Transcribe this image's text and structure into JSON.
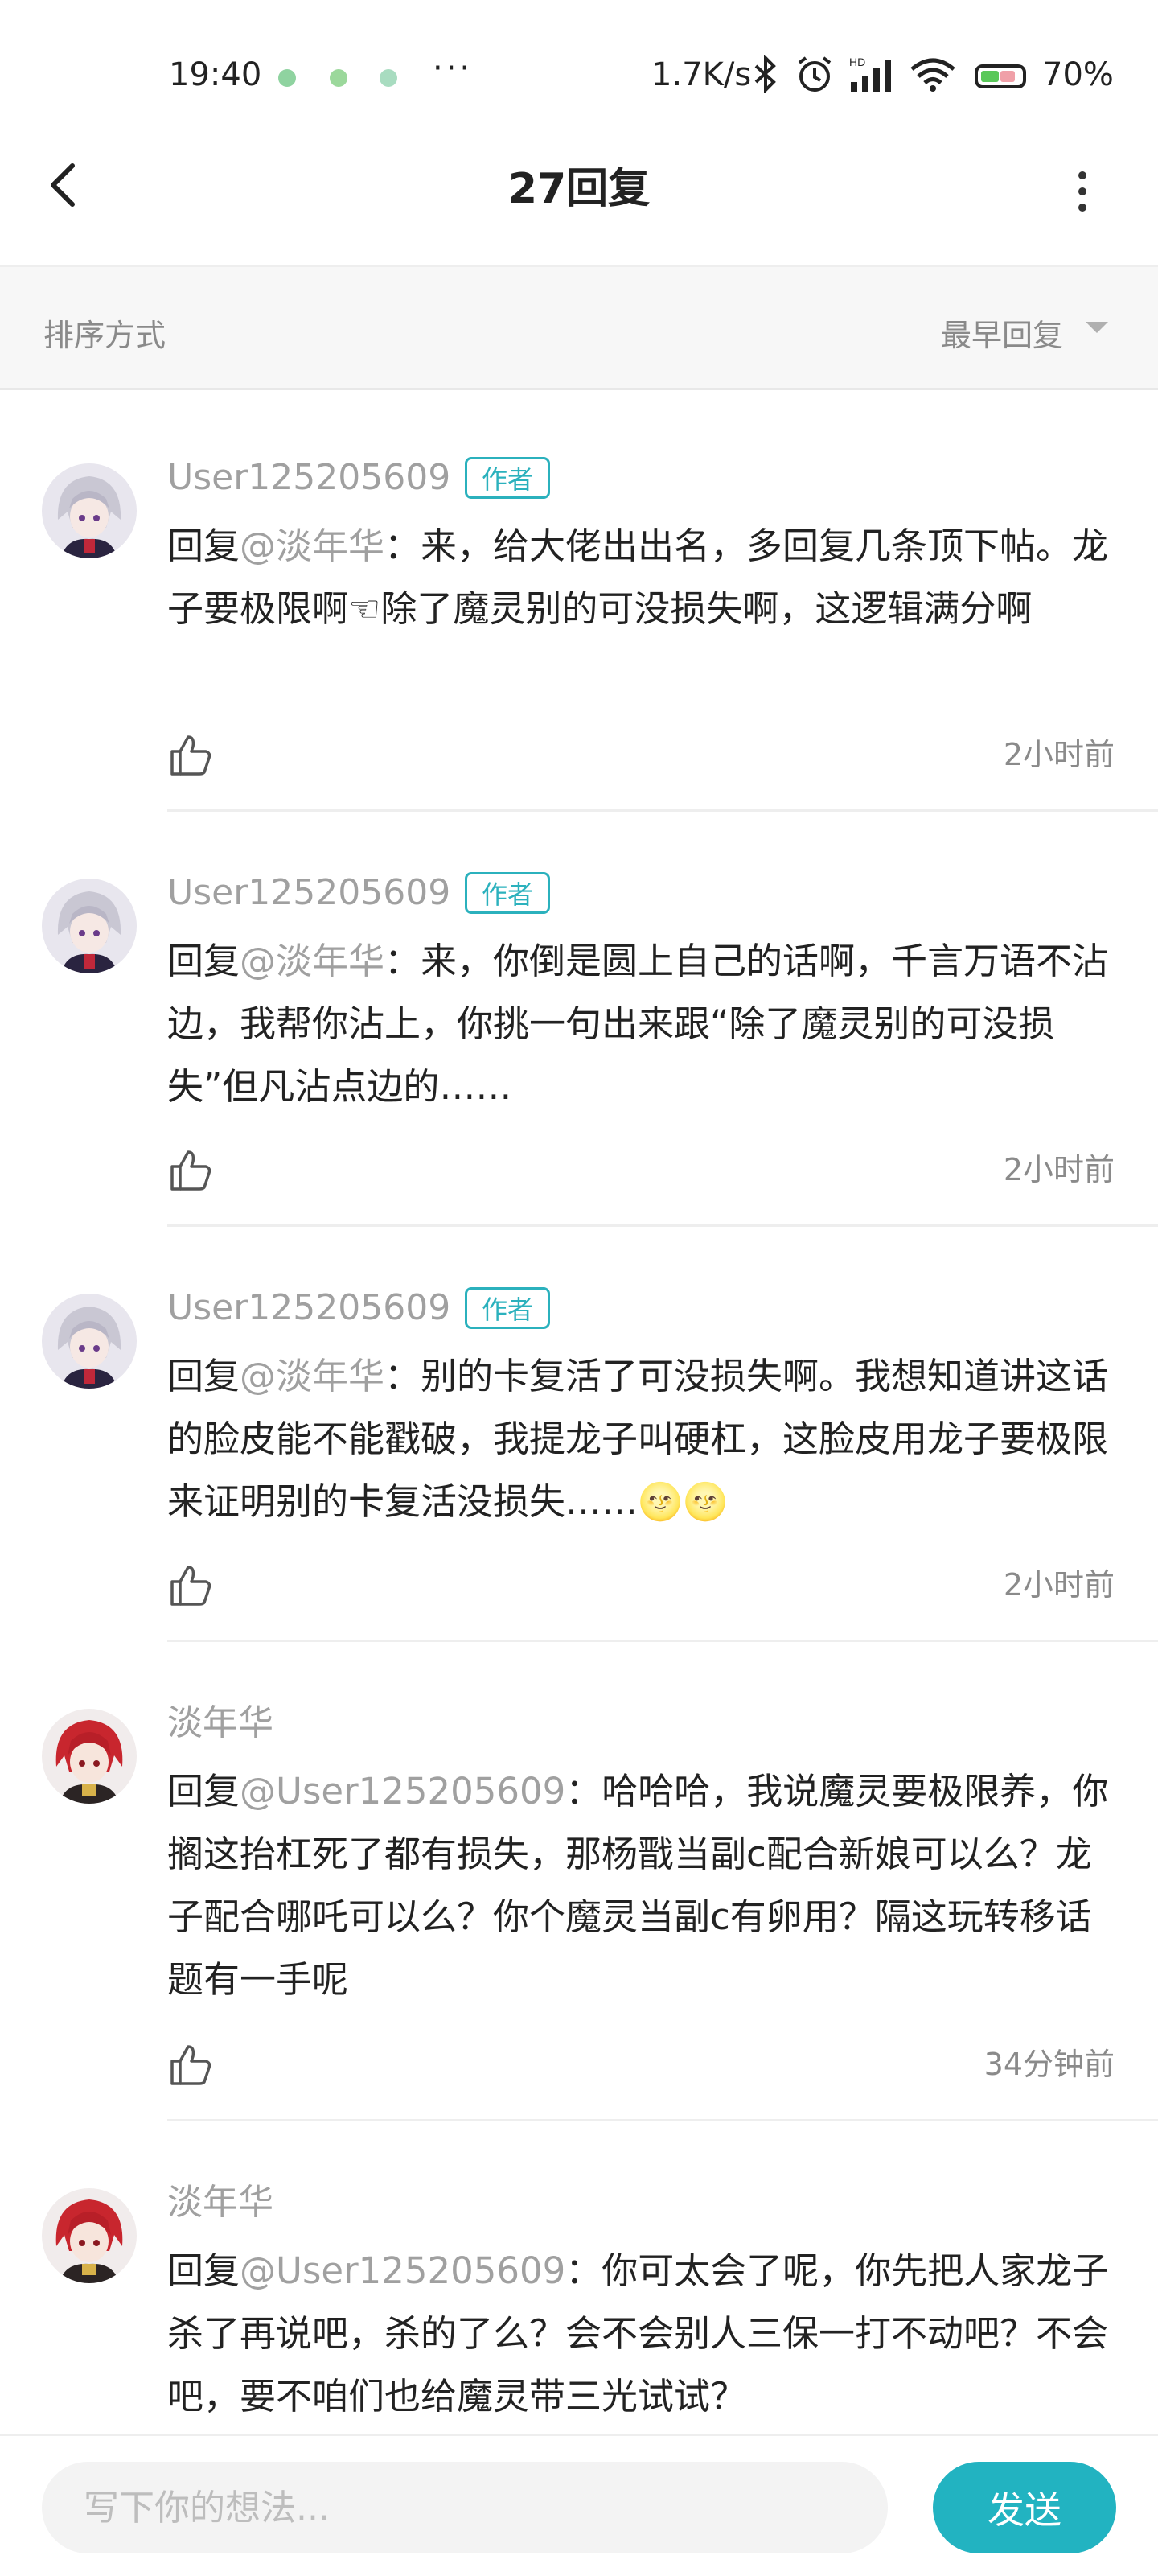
{
  "status_bar": {
    "time": "19:40",
    "more": "···",
    "network_speed": "1.7K/s",
    "battery": "70%",
    "icons": [
      "bluetooth-icon",
      "alarm-icon",
      "signal-icon",
      "wifi-icon",
      "battery-icon"
    ]
  },
  "header": {
    "title": "27回复"
  },
  "sort": {
    "label": "排序方式",
    "value": "最早回复"
  },
  "comments": [
    {
      "author": "User125205609",
      "badge": "作者",
      "reply_prefix": "回复",
      "mention": "@淡年华",
      "text": "：来，给大佬出出名，多回复几条顶下帖。龙子要极限啊☜除了魔灵别的可没损失啊，这逻辑满分啊",
      "time": "2小时前",
      "avatar": "silver-hair"
    },
    {
      "author": "User125205609",
      "badge": "作者",
      "reply_prefix": "回复",
      "mention": "@淡年华",
      "text": "：来，你倒是圆上自己的话啊，千言万语不沾边，我帮你沾上，你挑一句出来跟“除了魔灵别的可没损失”但凡沾点边的……",
      "time": "2小时前",
      "avatar": "silver-hair"
    },
    {
      "author": "User125205609",
      "badge": "作者",
      "reply_prefix": "回复",
      "mention": "@淡年华",
      "text": "：别的卡复活了可没损失啊。我想知道讲这话的脸皮能不能戳破，我提龙子叫硬杠，这脸皮用龙子要极限来证明别的卡复活没损失……🌝🌝",
      "time": "2小时前",
      "avatar": "silver-hair"
    },
    {
      "author": "淡年华",
      "badge": "",
      "reply_prefix": "回复",
      "mention": "@User125205609",
      "text": "：哈哈哈，我说魔灵要极限养，你搁这抬杠死了都有损失，那杨戬当副c配合新娘可以么？龙子配合哪吒可以么？你个魔灵当副c有卵用？隔这玩转移话题有一手呢",
      "time": "34分钟前",
      "avatar": "red-hair"
    },
    {
      "author": "淡年华",
      "badge": "",
      "reply_prefix": "回复",
      "mention": "@User125205609",
      "text": "：你可太会了呢，你先把人家龙子杀了再说吧，杀的了么？会不会别人三保一打不动吧？不会吧，要不咱们也给魔灵带三光试试？",
      "time": "",
      "avatar": "red-hair"
    }
  ],
  "composer": {
    "placeholder": "写下你的想法...",
    "send_label": "发送"
  },
  "colors": {
    "accent": "#22b3c1",
    "badge": "#2bb1bd",
    "muted": "#8a8a8a"
  }
}
